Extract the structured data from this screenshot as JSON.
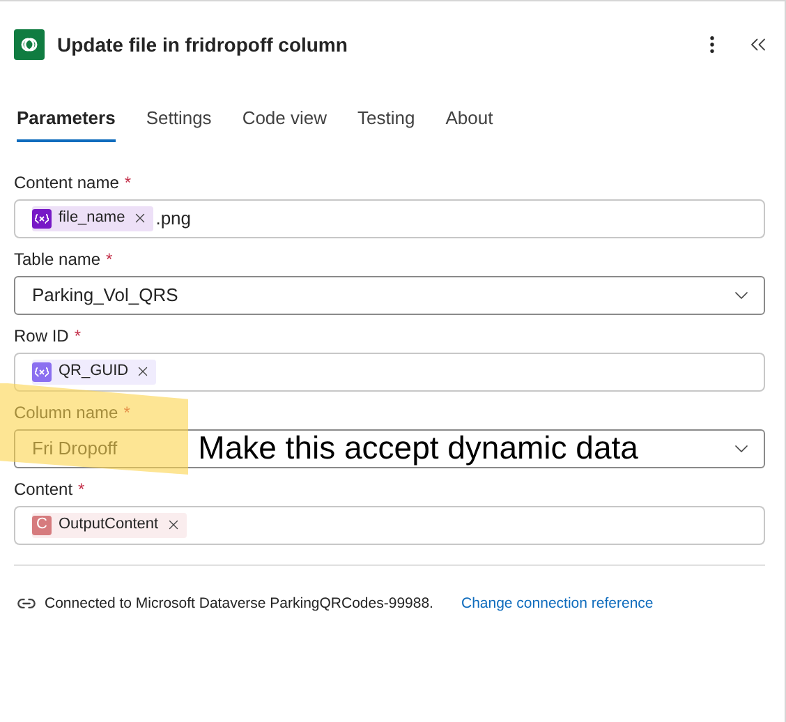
{
  "header": {
    "title": "Update file in fridropoff column"
  },
  "tabs": [
    {
      "label": "Parameters",
      "selected": true
    },
    {
      "label": "Settings",
      "selected": false
    },
    {
      "label": "Code view",
      "selected": false
    },
    {
      "label": "Testing",
      "selected": false
    },
    {
      "label": "About",
      "selected": false
    }
  ],
  "fields": [
    {
      "label": "Content name",
      "required_mark": "*",
      "kind": "tokens",
      "tokens": [
        {
          "text": "file_name",
          "kind": "variable",
          "color": "#7719c6"
        }
      ],
      "suffix": ".png"
    },
    {
      "label": "Table name",
      "required_mark": "*",
      "kind": "dropdown",
      "value": "Parking_Vol_QRS"
    },
    {
      "label": "Row ID",
      "required_mark": "*",
      "kind": "tokens",
      "tokens": [
        {
          "text": "QR_GUID",
          "kind": "variable",
          "color": "#8b6ff0"
        }
      ]
    },
    {
      "label": "Column name",
      "required_mark": "*",
      "kind": "dropdown",
      "value": "Fri Dropoff",
      "highlighted": true,
      "annotation": "Make this accept dynamic data"
    },
    {
      "label": "Content",
      "required_mark": "*",
      "kind": "tokens",
      "tokens": [
        {
          "text": "OutputContent",
          "kind": "letter",
          "letter": "C",
          "color": "#d67b7e"
        }
      ]
    }
  ],
  "connection": {
    "text": "Connected to Microsoft Dataverse ParkingQRCodes-99988.",
    "link": "Change connection reference"
  }
}
